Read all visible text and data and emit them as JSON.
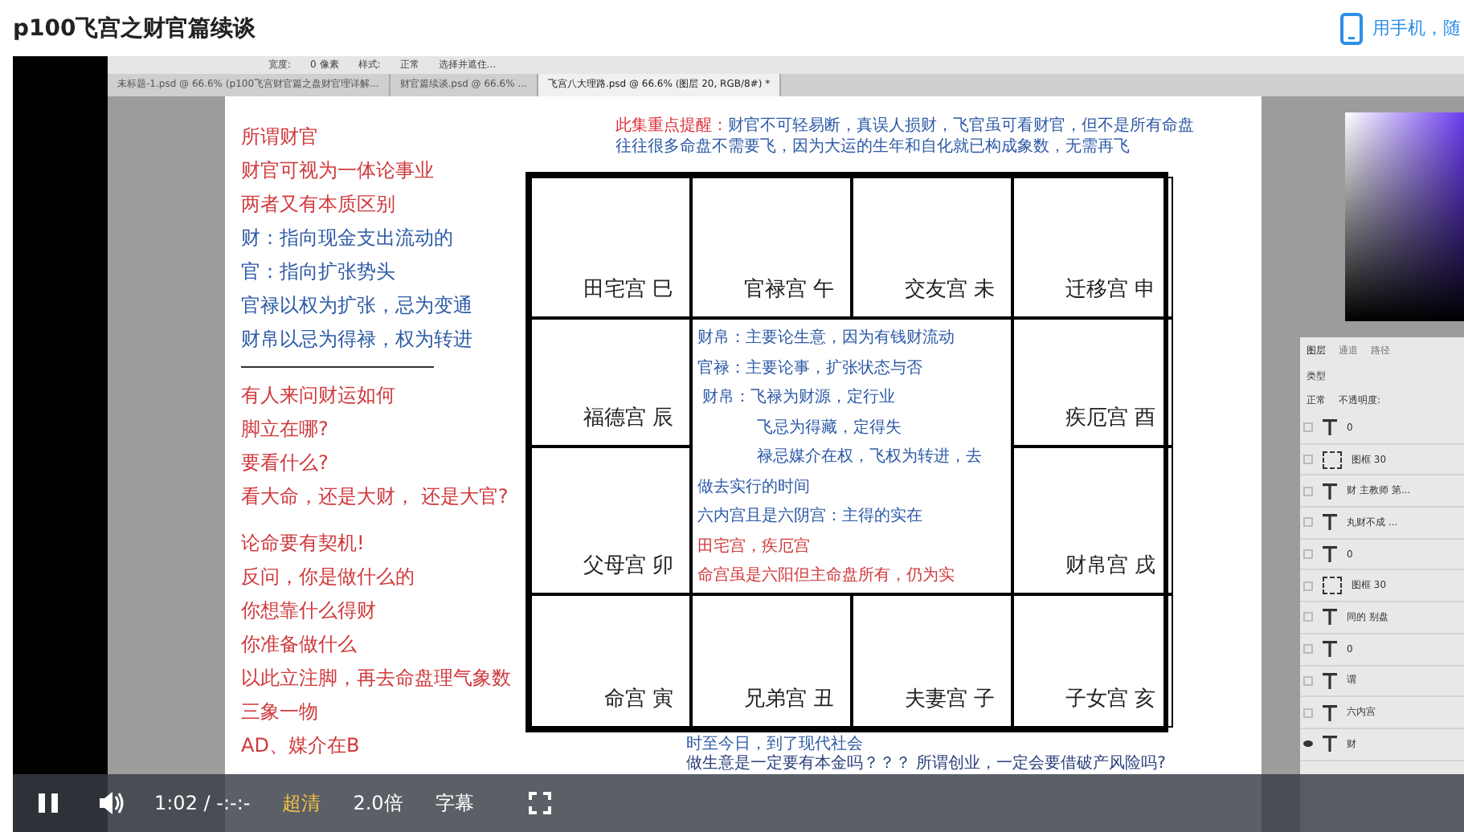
{
  "page_title": "p100飞宫之财官篇续谈",
  "mobile_link": "用手机，随",
  "ps": {
    "options": [
      "宽度:",
      "0 像素",
      "样式:",
      "正常",
      "选择并遮住..."
    ],
    "tabs": [
      {
        "label": "未标题-1.psd @ 66.6% (p100飞宫财官篇之盘财官理详解...",
        "selected": false
      },
      {
        "label": "财官篇续谈.psd @ 66.6% ...",
        "selected": false
      },
      {
        "label": "飞宫八大理路.psd @ 66.6% (图层 20, RGB/8#) *",
        "selected": true
      }
    ],
    "panel_tabs": [
      {
        "label": "图层",
        "selected": true
      },
      {
        "label": "通道",
        "selected": false
      },
      {
        "label": "路径",
        "selected": false
      }
    ],
    "layer_filter": "类型",
    "blend_mode": "正常",
    "opacity_label": "不透明度:",
    "layers": [
      {
        "kind": "text",
        "name": "0",
        "visible": false
      },
      {
        "kind": "frame",
        "name": "图框 30",
        "visible": false
      },
      {
        "kind": "text",
        "name": "财 主教师 第...",
        "visible": false
      },
      {
        "kind": "text",
        "name": "丸财不成 ...",
        "visible": false
      },
      {
        "kind": "text",
        "name": "0",
        "visible": false
      },
      {
        "kind": "frame",
        "name": "图框 30",
        "visible": false
      },
      {
        "kind": "text",
        "name": "同的 别盘",
        "visible": false
      },
      {
        "kind": "text",
        "name": "0",
        "visible": false
      },
      {
        "kind": "text",
        "name": "谓",
        "visible": false
      },
      {
        "kind": "text",
        "name": "六内宫",
        "visible": false
      },
      {
        "kind": "text",
        "name": "财",
        "visible": true
      }
    ]
  },
  "doc": {
    "note": {
      "lead": "此集重点提醒：",
      "lines": [
        "财官不可轻易断，真误人损财，飞官虽可看财官，但不是所有命盘",
        "往往很多命盘不需要飞，因为大运的生年和自化就已构成象数，无需再飞"
      ]
    },
    "left_lines": [
      {
        "kind": "text",
        "text": "所谓财官",
        "color": "#d0393c"
      },
      {
        "kind": "text",
        "text": "财官可视为一体论事业",
        "color": "#d0393c"
      },
      {
        "kind": "text",
        "text": "两者又有本质区别",
        "color": "#d0393c"
      },
      {
        "kind": "text",
        "text": "财：指向现金支出流动的",
        "color": "#2d5aa6"
      },
      {
        "kind": "text",
        "text": "官：指向扩张势头",
        "color": "#2d5aa6"
      },
      {
        "kind": "text",
        "text": "官禄以权为扩张，忌为变通",
        "color": "#2d5aa6"
      },
      {
        "kind": "text",
        "text": "财帛以忌为得禄，权为转进",
        "color": "#2d5aa6"
      },
      {
        "kind": "rule"
      },
      {
        "kind": "text",
        "text": "有人来问财运如何",
        "color": "#d0393c"
      },
      {
        "kind": "text",
        "text": "脚立在哪?",
        "color": "#d0393c"
      },
      {
        "kind": "text",
        "text": "要看什么?",
        "color": "#d0393c"
      },
      {
        "kind": "text",
        "text": "看大命，还是大财， 还是大官?",
        "color": "#d0393c"
      },
      {
        "kind": "break"
      },
      {
        "kind": "text",
        "text": "论命要有契机!",
        "color": "#d0393c"
      },
      {
        "kind": "text",
        "text": "反问，你是做什么的",
        "color": "#d0393c"
      },
      {
        "kind": "text",
        "text": "你想靠什么得财",
        "color": "#d0393c"
      },
      {
        "kind": "text",
        "text": "你准备做什么",
        "color": "#d0393c"
      },
      {
        "kind": "text",
        "text": "以此立注脚，再去命盘理气象数",
        "color": "#d0393c"
      },
      {
        "kind": "text",
        "text": "三象一物",
        "color": "#d0393c"
      },
      {
        "kind": "text",
        "text": "AD、媒介在B",
        "color": "#d0393c"
      }
    ],
    "palaces": [
      "田宅宫 巳",
      "官禄宫 午",
      "交友宫 未",
      "迁移宫 申",
      "福德宫 辰",
      "疾厄宫 酉",
      "父母宫 卯",
      "财帛宫 戌",
      "命宫 寅",
      "兄弟宫 丑",
      "夫妻宫 子",
      "子女宫 亥"
    ],
    "center_lines": [
      {
        "text": "财帛：主要论生意，因为有钱财流动",
        "color": "#2d5aa6"
      },
      {
        "text": "官禄：主要论事，扩张状态与否",
        "color": "#2d5aa6"
      },
      {
        "text": "财帛：飞禄为财源，定行业",
        "color": "#2d5aa6",
        "children": [
          {
            "text": "飞忌为得藏，定得失",
            "color": "#2d5aa6"
          },
          {
            "text": "禄忌媒介在权，飞权为转进，去",
            "color": "#2d5aa6"
          }
        ]
      },
      {
        "text": "做去实行的时间",
        "color": "#2d5aa6"
      },
      {
        "text": "六内宫且是六阴宫：主得的实在",
        "color": "#2d5aa6"
      },
      {
        "text": "田宅宫，疾厄宫",
        "color": "#d0393c"
      },
      {
        "text": "命宫虽是六阳但主命盘所有，仍为实",
        "color": "#d0393c"
      }
    ],
    "bottom_lines": [
      {
        "text": "时至今日，到了现代社会",
        "color": "#2d5aa6"
      },
      {
        "text": "做生意是一定要有本金吗？？？ 所谓创业，一定会要借破产风险吗?",
        "color": "#2a3f7a"
      }
    ]
  },
  "player": {
    "playing": true,
    "time": "1:02 / -:-:-",
    "quality": "超清",
    "speed": "2.0倍",
    "subtitles": "字幕"
  }
}
